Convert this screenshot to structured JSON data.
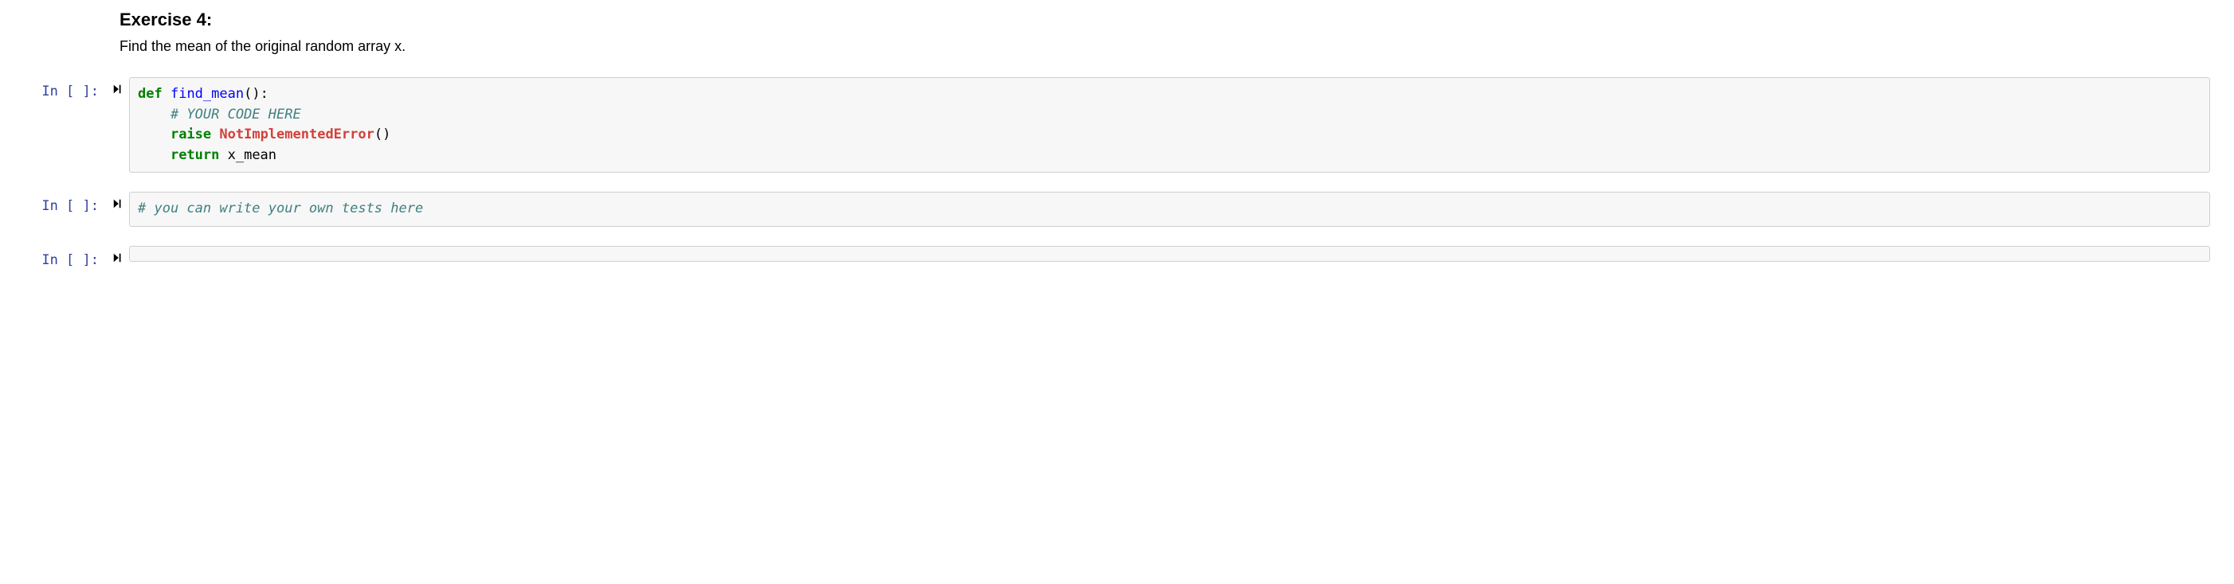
{
  "heading": "Exercise 4:",
  "description": "Find the mean of the original random array x.",
  "prompt_label": "In [ ]:",
  "cells": [
    {
      "code": {
        "l1_kw": "def",
        "l1_def": "find_mean",
        "l1_rest": "():",
        "l2_comment": "# YOUR CODE HERE",
        "l3_kw": "raise",
        "l3_exc": "NotImplementedError",
        "l3_rest": "()",
        "l4_kw": "return",
        "l4_rest": " x_mean"
      }
    },
    {
      "code": {
        "comment": "# you can write your own tests here"
      }
    },
    {
      "code": {
        "empty": ""
      }
    }
  ]
}
